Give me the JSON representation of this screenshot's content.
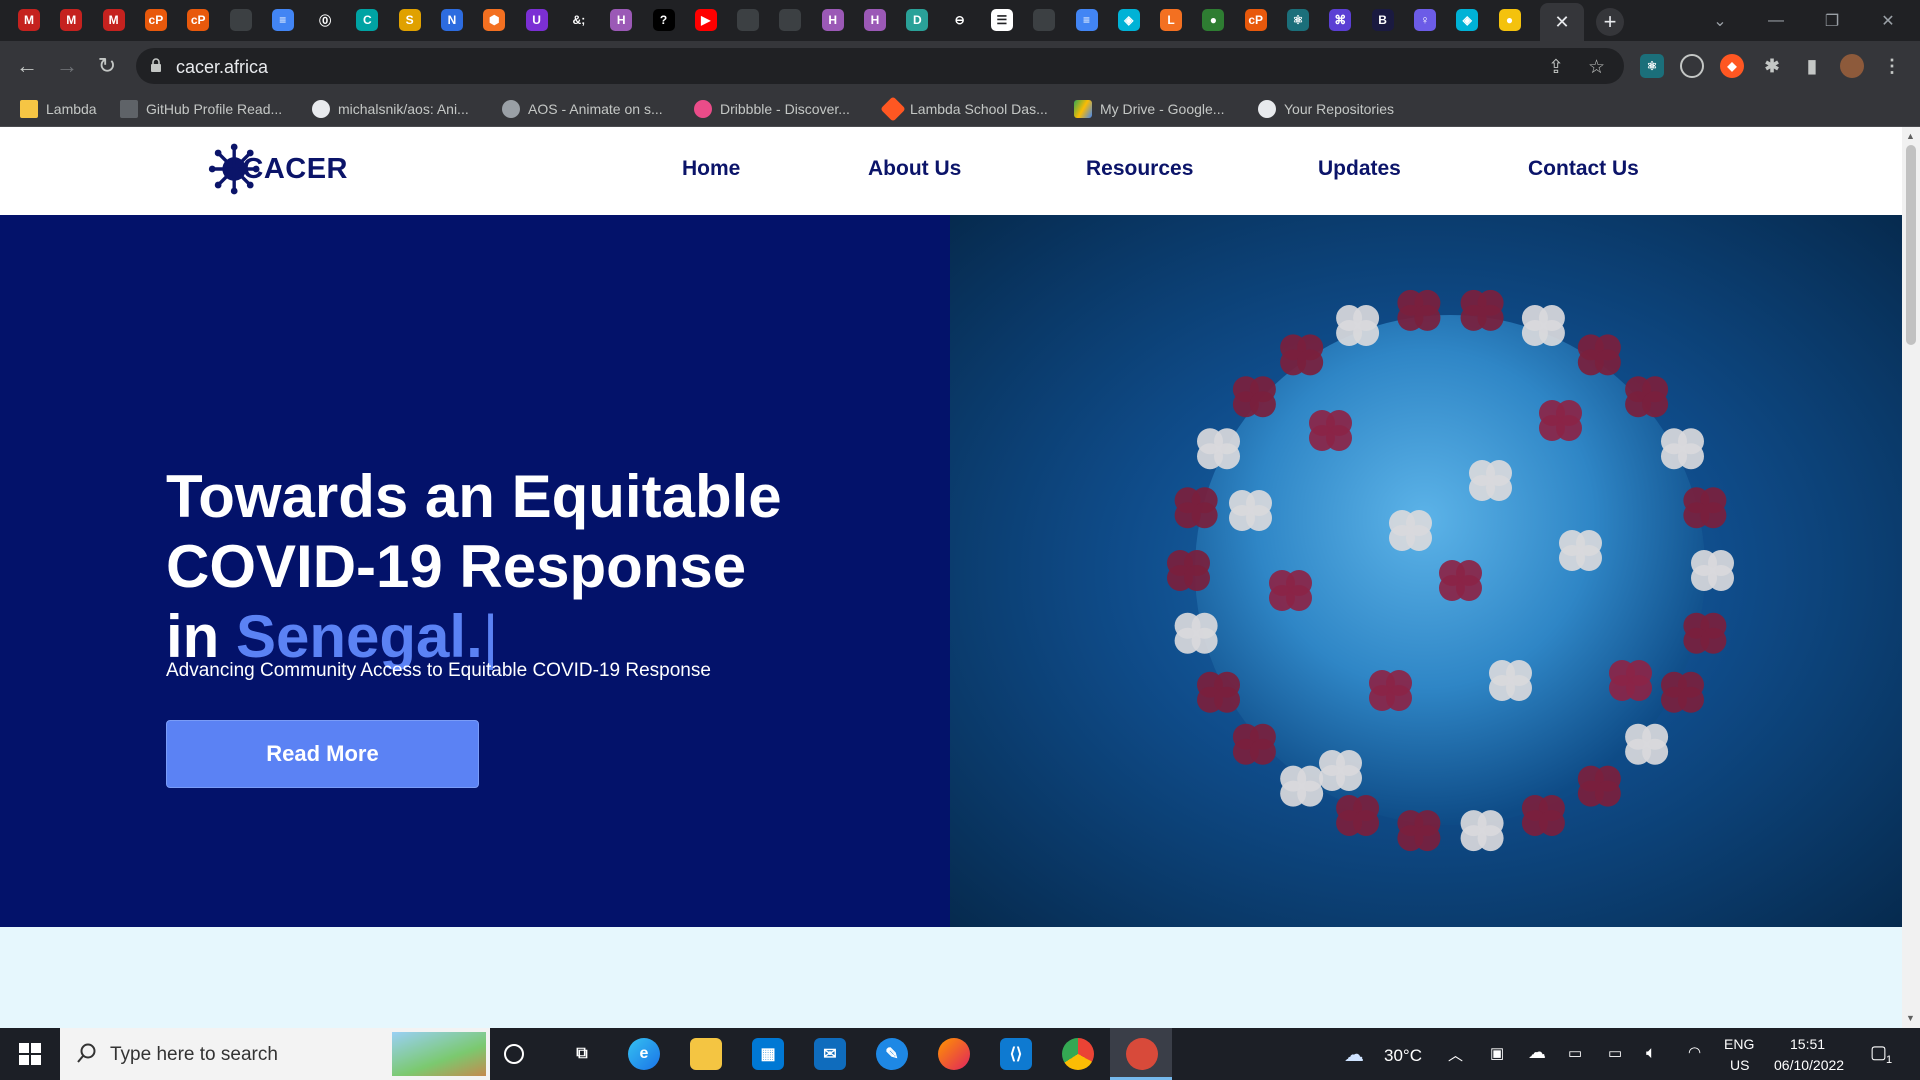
{
  "browser": {
    "url": "cacer.africa",
    "tabs": [
      "M",
      "M",
      "M",
      "cP",
      "cP",
      "",
      "≡",
      "⓪",
      "C",
      "S",
      "N",
      "⬢",
      "U",
      "&;",
      "H",
      "?",
      "▶",
      "",
      "",
      "H",
      "H",
      "D",
      "⊖",
      "☰",
      "",
      "≡",
      "◈",
      "L",
      "●",
      "cP",
      "⚛",
      "⌘",
      "B",
      "♀",
      "◈",
      "●"
    ],
    "active_tab_close": "✕",
    "new_tab": "+",
    "bookmarks": [
      {
        "label": "Lambda",
        "icon": "folder-icon"
      },
      {
        "label": "GitHub Profile Read...",
        "icon": "md-icon"
      },
      {
        "label": "michalsnik/aos: Ani...",
        "icon": "github-icon"
      },
      {
        "label": "AOS - Animate on s...",
        "icon": "globe-icon"
      },
      {
        "label": "Dribbble - Discover...",
        "icon": "dribbble-icon"
      },
      {
        "label": "Lambda School Das...",
        "icon": "lambda-icon"
      },
      {
        "label": "My Drive - Google...",
        "icon": "drive-icon"
      },
      {
        "label": "Your Repositories",
        "icon": "github-icon"
      }
    ]
  },
  "site": {
    "logo": "CACER",
    "nav": [
      "Home",
      "About Us",
      "Resources",
      "Updates",
      "Contact Us"
    ],
    "hero": {
      "title_line1": "Towards an Equitable",
      "title_line2": "COVID-19 Response",
      "title_in": "in",
      "title_highlight": "Senegal.",
      "caret": "|",
      "subtitle": "Advancing Community Access to Equitable COVID-19 Response",
      "button": "Read More"
    },
    "colors": {
      "navy": "#03126a",
      "accent": "#5b82f4",
      "light_section": "#e6f7fd"
    }
  },
  "taskbar": {
    "search_placeholder": "Type here to search",
    "weather": "30°C",
    "lang": "ENG",
    "region": "US",
    "time": "15:51",
    "date": "06/10/2022",
    "notifications": "1"
  }
}
